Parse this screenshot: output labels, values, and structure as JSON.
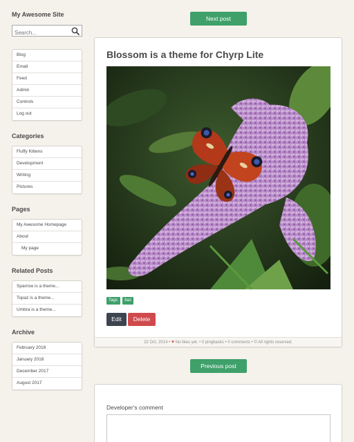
{
  "site": {
    "title": "My Awesome Site"
  },
  "search": {
    "placeholder": "Search..."
  },
  "menu": {
    "items": [
      "Blog",
      "Email",
      "Feed",
      "Admin",
      "Controls",
      "Log out"
    ]
  },
  "categories": {
    "title": "Categories",
    "items": [
      "Fluffy Kittens",
      "Development",
      "Writing",
      "Pictures"
    ]
  },
  "pages": {
    "title": "Pages",
    "items": [
      "My Awesome Homepage",
      "About",
      "My page"
    ]
  },
  "related": {
    "title": "Related Posts",
    "items": [
      "Sparrow is a theme...",
      "Topaz is a theme...",
      "Umbra is a theme..."
    ]
  },
  "archive": {
    "title": "Archive",
    "items": [
      "February 2018",
      "January 2018",
      "December 2017",
      "August 2017"
    ]
  },
  "nav": {
    "next": "Next post",
    "previous": "Previous post"
  },
  "post": {
    "title": "Blossom is a theme for Chyrp Lite",
    "tags_label": "Tags:",
    "tag": "baz",
    "edit": "Edit",
    "delete": "Delete",
    "date": "22 Oct, 2014",
    "likes": "No likes yet.",
    "pingbacks": "0 pingbacks",
    "comments": "0 comments",
    "rights": "© All rights reserved."
  },
  "comment": {
    "label": "Developer's comment"
  },
  "colors": {
    "accent": "#3fa06a",
    "danger": "#cf4a4c",
    "dark": "#3d4450",
    "background": "#f5f2ec"
  },
  "icons": {
    "search": "search-icon",
    "heart": "heart-icon"
  }
}
